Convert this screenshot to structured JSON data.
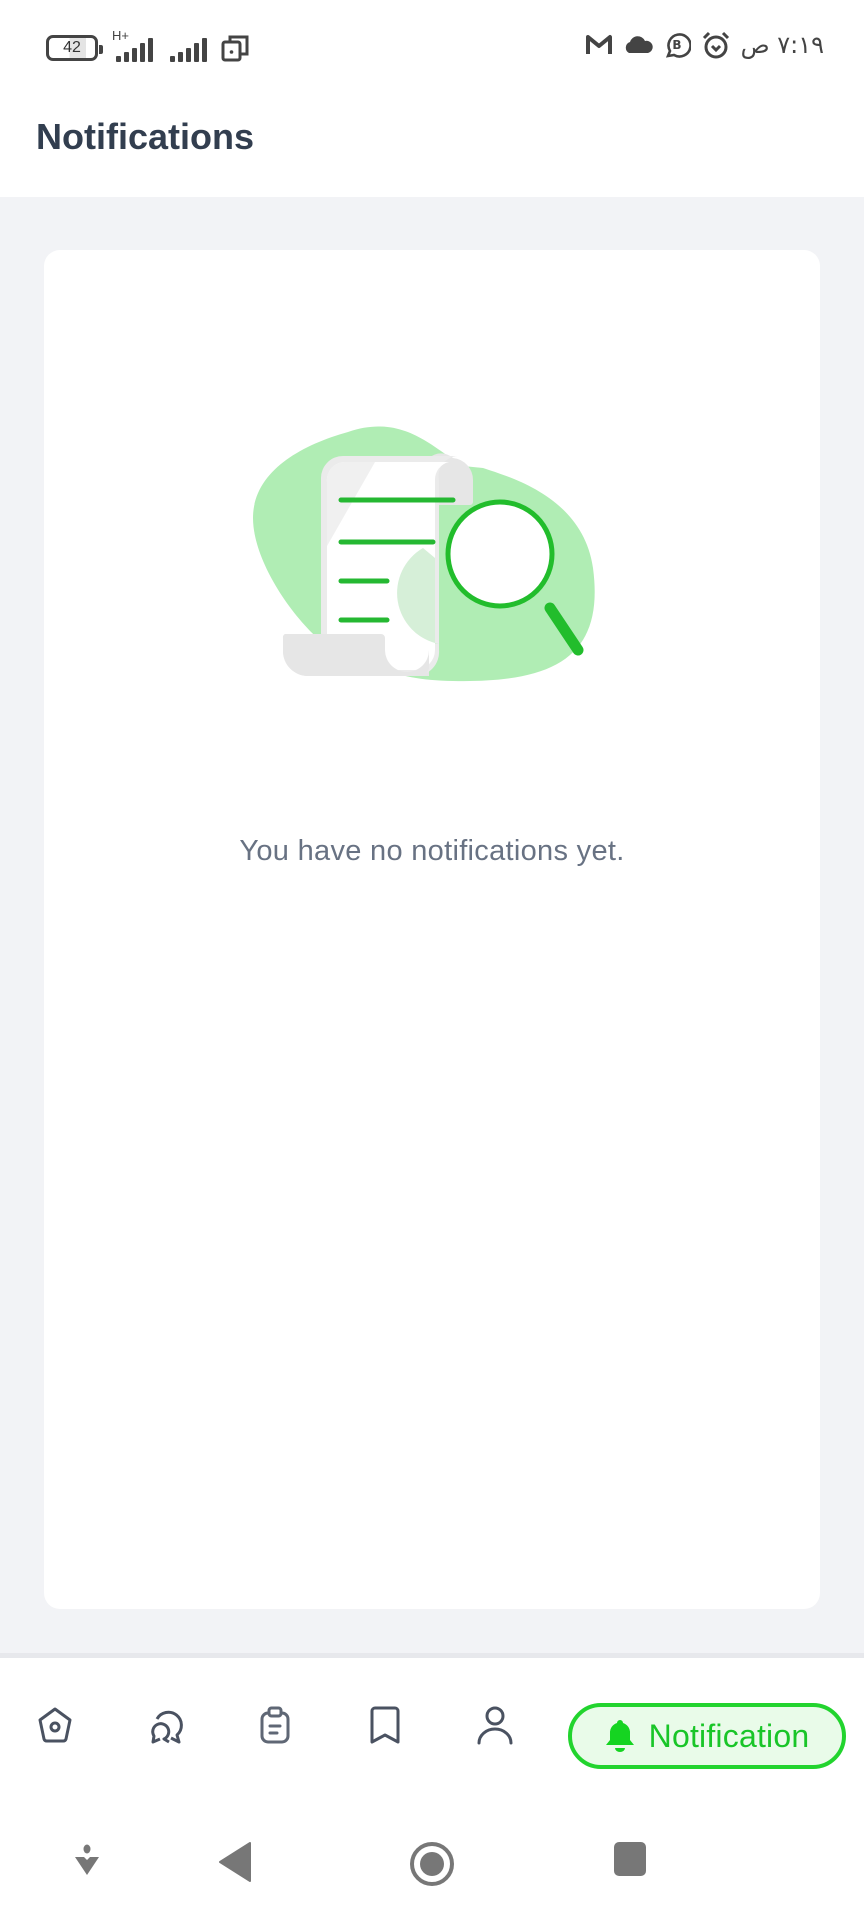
{
  "status_bar": {
    "battery_level": "42",
    "network_type": "H+",
    "time": "٧:١٩ ص",
    "icons_left": [
      "battery-icon",
      "signal-icon",
      "signal-icon",
      "dual-sim-icon"
    ],
    "icons_right": [
      "gmail-icon",
      "cloud-icon",
      "business-chat-icon",
      "alarm-icon"
    ]
  },
  "header": {
    "title": "Notifications"
  },
  "main": {
    "empty_state": {
      "illustration": "document-search-illustration",
      "message": "You have no notifications yet."
    }
  },
  "bottom_nav": {
    "items": [
      {
        "name": "home",
        "icon": "home-icon"
      },
      {
        "name": "messages",
        "icon": "chat-bubbles-icon"
      },
      {
        "name": "tasks",
        "icon": "clipboard-icon"
      },
      {
        "name": "saved",
        "icon": "bookmark-icon"
      },
      {
        "name": "profile",
        "icon": "person-icon"
      }
    ],
    "active": {
      "name": "notification",
      "icon": "bell-icon",
      "label": "Notification"
    }
  },
  "colors": {
    "accent_green": "#22d42e",
    "accent_green_text": "#19c528",
    "pill_background": "#e9fbe9",
    "title_color": "#323e4f",
    "muted_text": "#687283",
    "content_background": "#f2f3f6",
    "icon_color": "#4a5261"
  },
  "system_nav": {
    "buttons": [
      "keyboard-hide",
      "back",
      "home",
      "recents"
    ]
  }
}
